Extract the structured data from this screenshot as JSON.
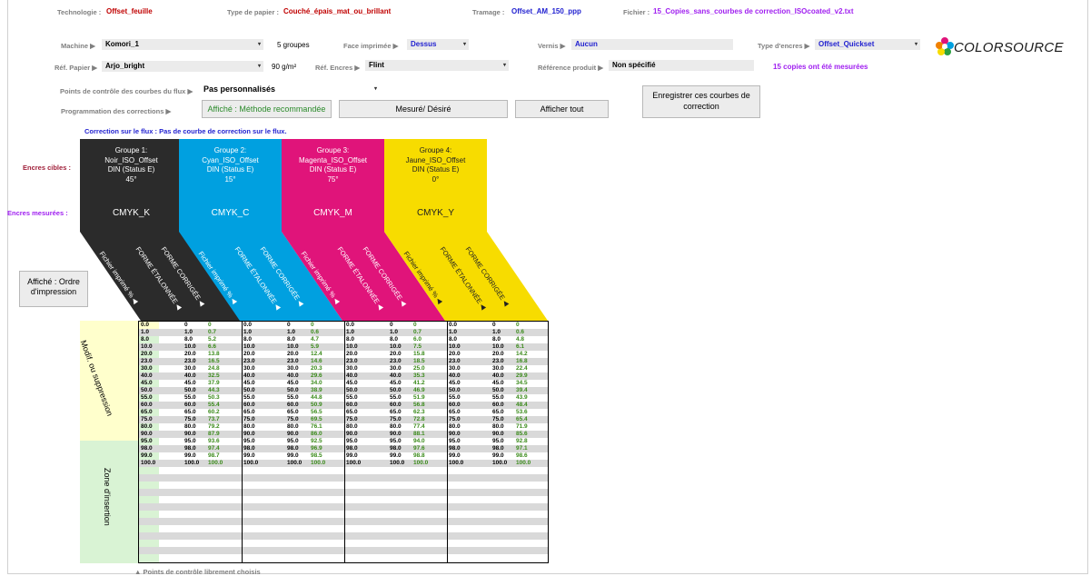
{
  "header": {
    "technologie": {
      "label": "Technologie :",
      "value": "Offset_feuille"
    },
    "type_papier": {
      "label": "Type de papier :",
      "value": "Couché_épais_mat_ou_brillant"
    },
    "tramage": {
      "label": "Tramage :",
      "value": "Offset_AM_150_ppp"
    },
    "fichier": {
      "label": "Fichier :",
      "value": "15_Copies_sans_courbes de correction_ISOcoated_v2.txt"
    },
    "machine": {
      "label": "Machine ▶",
      "value": "Komori_1",
      "groupes": "5 groupes"
    },
    "face": {
      "label": "Face imprimée ▶",
      "value": "Dessus"
    },
    "vernis": {
      "label": "Vernis ▶",
      "value": "Aucun"
    },
    "type_encres": {
      "label": "Type d'encres ▶",
      "value": "Offset_Quickset"
    },
    "ref_papier": {
      "label": "Réf. Papier ▶",
      "value": "Arjo_bright",
      "grammage": "90 g/m²"
    },
    "ref_encres": {
      "label": "Réf. Encres ▶",
      "value": "Flint"
    },
    "ref_produit": {
      "label": "Référence produit ▶",
      "value": "Non spécifié"
    },
    "copies": "15 copies ont été mesurées",
    "logo": "COLORSOURCE"
  },
  "controls": {
    "points_label": "Points de contrôle des courbes du flux ▶",
    "points_value": "Pas personnalisés",
    "prog_label": "Programmation des corrections ▶",
    "btn_affiche": "Affiché : Méthode recommandée",
    "btn_mesure": "Mesuré/ Désiré",
    "btn_afficher_tout": "Afficher tout",
    "btn_enregistrer": "Enregistrer ces courbes de correction",
    "correction_note": "Correction sur le flux : Pas de courbe de correction sur le flux.",
    "btn_ordre": "Affiché : Ordre d'impression"
  },
  "side_labels": {
    "encres_cibles": "Encres cibles :",
    "encres_mesurees": "Encres mesurées :",
    "modif": "Modif. ou suppression",
    "zone": "Zone d'insertion",
    "footnote": "▲ Points de contrôle librement choisis"
  },
  "groups": [
    {
      "title1": "Groupe 1:",
      "title2": "Noir_ISO_Offset",
      "title3": "DIN (Status E)",
      "angle": "45°",
      "measured": "CMYK_K",
      "color": "#2b2b2b"
    },
    {
      "title1": "Groupe 2:",
      "title2": "Cyan_ISO_Offset",
      "title3": "DIN (Status E)",
      "angle": "15°",
      "measured": "CMYK_C",
      "color": "#00a0e0"
    },
    {
      "title1": "Groupe 3:",
      "title2": "Magenta_ISO_Offset",
      "title3": "DIN (Status E)",
      "angle": "75°",
      "measured": "CMYK_M",
      "color": "#e0147a"
    },
    {
      "title1": "Groupe 4:",
      "title2": "Jaune_ISO_Offset",
      "title3": "DIN (Status E)",
      "angle": "0°",
      "measured": "CMYK_Y",
      "color": "#f7dc00"
    }
  ],
  "diag_labels": {
    "fichier": "Fichier imprimé %",
    "forme_etal": "FORME ÉTALONNÉE",
    "forme_corr": "FORME CORRIGÉE"
  },
  "table": {
    "rows": [
      {
        "f": "0.0",
        "e": "0",
        "c": [
          "0",
          "0",
          "0",
          "0"
        ],
        "ff": [
          "0",
          "0",
          "0",
          "0"
        ],
        "ee": [
          "0",
          "0",
          "0",
          "0"
        ]
      },
      {
        "f": "1.0",
        "e": "1.0",
        "c": [
          "0.7",
          "0.6",
          "0.7",
          "0.6"
        ]
      },
      {
        "f": "8.0",
        "e": "8.0",
        "c": [
          "5.2",
          "4.7",
          "6.0",
          "4.8"
        ]
      },
      {
        "f": "10.0",
        "e": "10.0",
        "c": [
          "6.6",
          "5.9",
          "7.5",
          "6.1"
        ]
      },
      {
        "f": "20.0",
        "e": "20.0",
        "c": [
          "13.8",
          "12.4",
          "15.8",
          "14.2"
        ]
      },
      {
        "f": "23.0",
        "e": "23.0",
        "c": [
          "16.5",
          "14.6",
          "18.5",
          "16.8"
        ]
      },
      {
        "f": "30.0",
        "e": "30.0",
        "c": [
          "24.8",
          "20.3",
          "25.0",
          "22.4"
        ]
      },
      {
        "f": "40.0",
        "e": "40.0",
        "c": [
          "32.5",
          "29.6",
          "35.3",
          "29.9"
        ]
      },
      {
        "f": "45.0",
        "e": "45.0",
        "c": [
          "37.9",
          "34.0",
          "41.2",
          "34.5"
        ]
      },
      {
        "f": "50.0",
        "e": "50.0",
        "c": [
          "44.3",
          "38.9",
          "46.9",
          "39.4"
        ]
      },
      {
        "f": "55.0",
        "e": "55.0",
        "c": [
          "50.3",
          "44.8",
          "51.9",
          "43.9"
        ]
      },
      {
        "f": "60.0",
        "e": "60.0",
        "c": [
          "55.4",
          "50.9",
          "56.8",
          "48.4"
        ]
      },
      {
        "f": "65.0",
        "e": "65.0",
        "c": [
          "60.2",
          "56.5",
          "62.3",
          "53.6"
        ]
      },
      {
        "f": "75.0",
        "e": "75.0",
        "c": [
          "73.7",
          "69.5",
          "72.8",
          "65.4"
        ]
      },
      {
        "f": "80.0",
        "e": "80.0",
        "c": [
          "79.2",
          "76.1",
          "77.4",
          "71.9"
        ]
      },
      {
        "f": "90.0",
        "e": "90.0",
        "c": [
          "87.9",
          "86.0",
          "88.1",
          "85.6"
        ]
      },
      {
        "f": "95.0",
        "e": "95.0",
        "c": [
          "93.6",
          "92.5",
          "94.0",
          "92.8"
        ]
      },
      {
        "f": "98.0",
        "e": "98.0",
        "c": [
          "97.4",
          "96.9",
          "97.6",
          "97.1"
        ]
      },
      {
        "f": "99.0",
        "e": "99.0",
        "c": [
          "98.7",
          "98.5",
          "98.8",
          "98.6"
        ]
      },
      {
        "f": "100.0",
        "e": "100.0",
        "c": [
          "100.0",
          "100.0",
          "100.0",
          "100.0"
        ]
      }
    ]
  }
}
